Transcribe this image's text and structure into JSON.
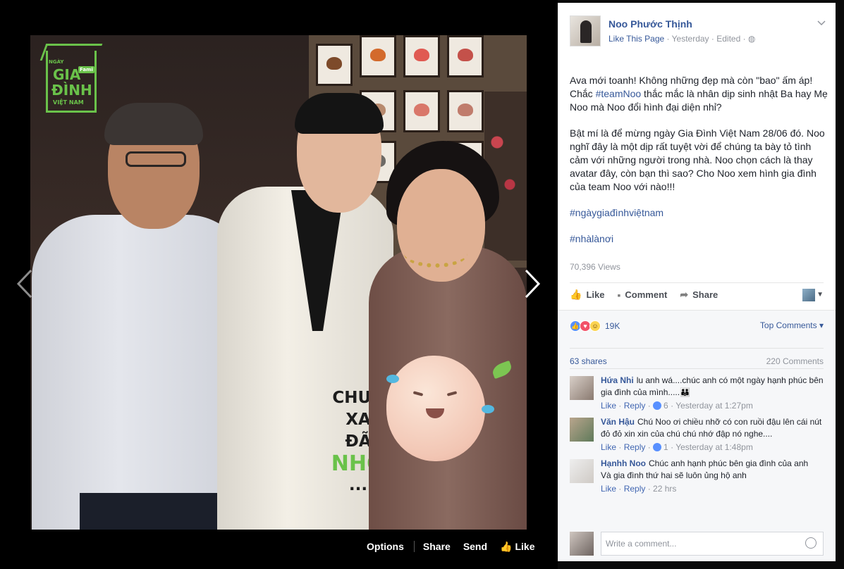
{
  "viewer": {
    "logo": {
      "l1": "NGÀY",
      "l2": "GIA",
      "l3": "ĐÌNH",
      "l4": "VIỆT NAM",
      "fami": "Fami"
    },
    "sticker_text": {
      "l1": "CHƯA",
      "l2": "XA",
      "l3": "ĐÃ",
      "l4": "NHỚ",
      "l5": "..."
    },
    "actions": {
      "options": "Options",
      "share": "Share",
      "send": "Send",
      "like": "Like"
    }
  },
  "post": {
    "page_name": "Noo Phước Thịnh",
    "like_page": "Like This Page",
    "meta_time": "· Yesterday · Edited ·",
    "paragraphs": [
      "Ava mới toanh! Không những đẹp mà còn \"bao\" ấm áp! Chắc ",
      "Bật mí là để mừng ngày Gia Đình Việt Nam 28/06 đó. Noo nghĩ đây là một dịp rất tuyệt vời để chúng ta bày tỏ tình cảm với những người trong nhà. Noo chọn cách là thay avatar đây, còn bạn thì sao? Cho Noo xem hình gia đình của team Noo với nào!!!"
    ],
    "p1_tag": "#teamNoo",
    "p1_tail": " thắc mắc là nhân dịp sinh nhật Ba hay Mẹ Noo mà Noo đổi hình đại diện nhỉ?",
    "hashtag1": "#ngàygiađìnhviệtnam",
    "hashtag2": "#nhàlànơi",
    "views": "70,396 Views",
    "actions": {
      "like": "Like",
      "comment": "Comment",
      "share": "Share"
    }
  },
  "feedback": {
    "reaction_count": "19K",
    "top_comments": "Top Comments",
    "shares": "63 shares",
    "comments_count": "220 Comments",
    "comments": [
      {
        "author": "Hứa Nhi",
        "text": "lu anh wá....chúc anh có một ngày hạnh phúc bên gia đình của mình.....👪",
        "like": "Like",
        "reply": "Reply",
        "reacts": "6",
        "time": "Yesterday at 1:27pm"
      },
      {
        "author": "Văn Hậu",
        "text": "Chú Noo ơi chiều nhỡ có con ruồi đậu lên cái nút đỏ đỏ xin xin của chú chú nhớ đập nó nghe....",
        "like": "Like",
        "reply": "Reply",
        "reacts": "1",
        "time": "Yesterday at 1:48pm"
      },
      {
        "author": "Hạnhh Noo",
        "text": "Chúc anh hạnh phúc bên gia đình của anh",
        "text2": "Và gia đình thứ hai sẽ luôn ủng hộ anh",
        "like": "Like",
        "reply": "Reply",
        "time": "22 hrs"
      }
    ],
    "write_placeholder": "Write a comment..."
  },
  "colors": {
    "link": "#365899",
    "bg": "#000000",
    "muted": "#90949c"
  }
}
